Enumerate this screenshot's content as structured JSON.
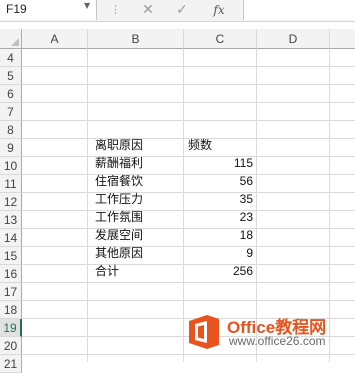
{
  "formula_bar": {
    "name_box": "F19",
    "cancel_icon": "✕",
    "enter_icon": "✓",
    "fx_icon": "fx",
    "formula": ""
  },
  "columns": [
    "A",
    "B",
    "C",
    "D"
  ],
  "rows": [
    "4",
    "5",
    "6",
    "7",
    "8",
    "9",
    "10",
    "11",
    "12",
    "13",
    "14",
    "15",
    "16",
    "17",
    "18",
    "19",
    "20",
    "21"
  ],
  "selected_row": "19",
  "table": {
    "header": {
      "reason": "离职原因",
      "count": "频数"
    },
    "rows": [
      {
        "reason": "薪酬福利",
        "count": "115"
      },
      {
        "reason": "住宿餐饮",
        "count": "56"
      },
      {
        "reason": "工作压力",
        "count": "35"
      },
      {
        "reason": "工作氛围",
        "count": "23"
      },
      {
        "reason": "发展空间",
        "count": "18"
      },
      {
        "reason": "其他原因",
        "count": "9"
      },
      {
        "reason": "合计",
        "count": "256"
      }
    ]
  },
  "watermark": {
    "title_latin": "Office",
    "title_cn": "教程网",
    "url": "www.office26.com",
    "accent": "#e8531f"
  }
}
